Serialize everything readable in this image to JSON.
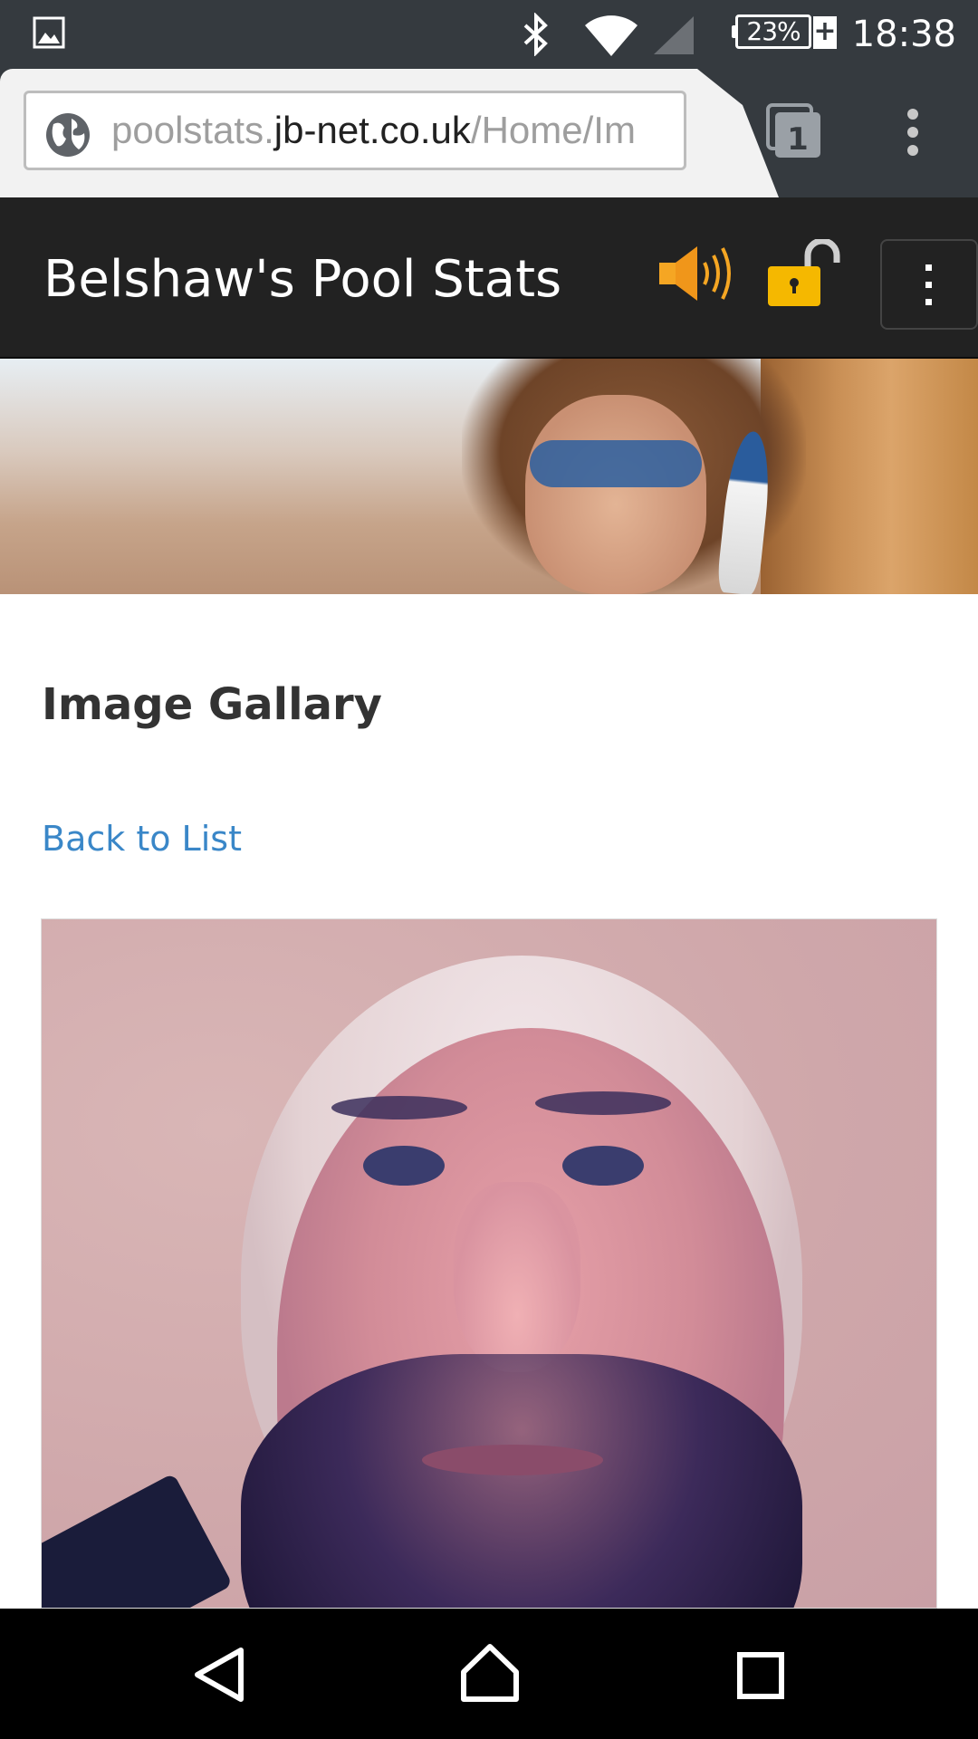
{
  "status_bar": {
    "battery_percent": "23%",
    "charging": "+",
    "time": "18:38",
    "icons": [
      "gallery-icon",
      "bluetooth-icon",
      "wifi-icon",
      "signal-icon",
      "battery-icon"
    ]
  },
  "browser": {
    "url_prefix": "poolstats.",
    "url_domain": "jb-net.co.uk",
    "url_path": "/Home/Im",
    "tab_count": "1"
  },
  "app_header": {
    "title": "Belshaw's Pool Stats",
    "icons": [
      "speaker-icon",
      "unlock-icon",
      "menu-icon"
    ],
    "accent_color": "#f5a623"
  },
  "content": {
    "title": "Image Gallary",
    "back_link": "Back to List"
  },
  "nav_bar": {
    "icons": [
      "back-icon",
      "home-icon",
      "recents-icon"
    ]
  }
}
